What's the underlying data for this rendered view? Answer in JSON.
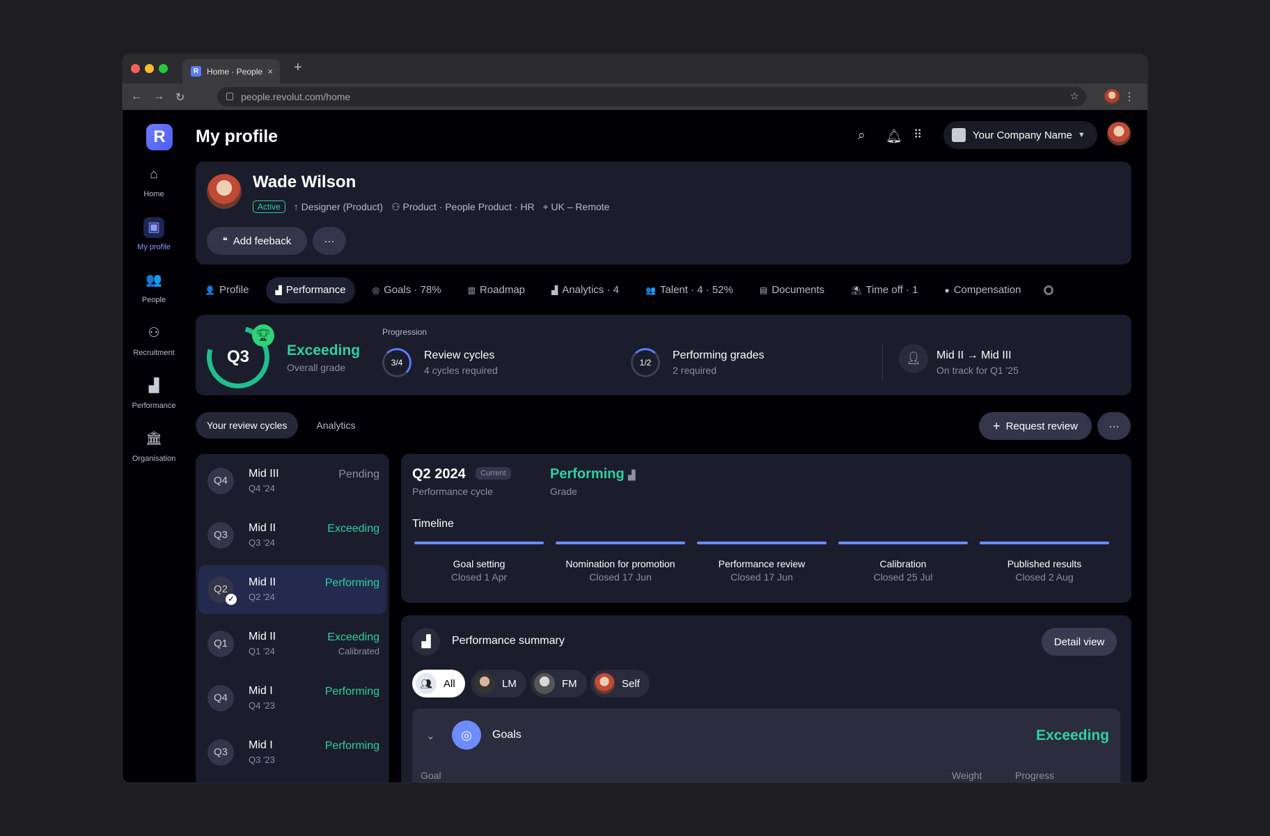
{
  "browser": {
    "tab_title": "Home · People",
    "tab_close": "×",
    "new_tab": "+",
    "url": "people.revolut.com/home"
  },
  "header": {
    "logo": "R",
    "page_title": "My profile",
    "company": "Your Company Name"
  },
  "sidenav": [
    {
      "label": "Home",
      "icon": "home-icon",
      "glyph": "⌂"
    },
    {
      "label": "My profile",
      "icon": "profile-card-icon",
      "glyph": "▣"
    },
    {
      "label": "People",
      "icon": "people-icon",
      "glyph": "👥"
    },
    {
      "label": "Recruitment",
      "icon": "recruitment-icon",
      "glyph": "⚇"
    },
    {
      "label": "Performance",
      "icon": "performance-icon",
      "glyph": "▟"
    },
    {
      "label": "Organisation",
      "icon": "organisation-icon",
      "glyph": "🏛"
    }
  ],
  "profile": {
    "name": "Wade Wilson",
    "status": "Active",
    "role": "Designer (Product)",
    "department": "Product · People Product · HR",
    "location": "UK – Remote",
    "add_feedback": "Add feeback",
    "more": "···"
  },
  "tabs": [
    {
      "label": "Profile",
      "glyph": "👤"
    },
    {
      "label": "Performance",
      "glyph": "▟"
    },
    {
      "label": "Goals · 78%",
      "glyph": "◎"
    },
    {
      "label": "Roadmap",
      "glyph": "▥"
    },
    {
      "label": "Analytics · 4",
      "glyph": "▟"
    },
    {
      "label": "Talent · 4 · 52%",
      "glyph": "👥"
    },
    {
      "label": "Documents",
      "glyph": "▤"
    },
    {
      "label": "Time off · 1",
      "glyph": "⛱"
    },
    {
      "label": "Compensation",
      "glyph": "●"
    }
  ],
  "grade": {
    "quarter": "Q3",
    "label": "Exceeding",
    "sub": "Overall grade",
    "progression_title": "Progression",
    "review_cycles": {
      "ring": "3/4",
      "title": "Review cycles",
      "sub": "4 cycles required",
      "progress": 0.75
    },
    "performing_grades": {
      "ring": "1/2",
      "title": "Performing grades",
      "sub": "2 required",
      "progress": 0.5
    },
    "next_level": {
      "title": "Mid II → Mid III",
      "sub": "On track for Q1 '25"
    }
  },
  "pill_tabs": [
    "Your review cycles",
    "Analytics"
  ],
  "actions": {
    "request_review": "Request review",
    "more": "···"
  },
  "cycles": [
    {
      "q": "Q4",
      "level": "Mid III",
      "date": "Q4 '24",
      "status": "Pending",
      "status_color": "grey",
      "sub": ""
    },
    {
      "q": "Q3",
      "level": "Mid II",
      "date": "Q3 '24",
      "status": "Exceeding",
      "status_color": "green",
      "sub": ""
    },
    {
      "q": "Q2",
      "level": "Mid II",
      "date": "Q2 '24",
      "status": "Performing",
      "status_color": "green",
      "sub": "",
      "active": true
    },
    {
      "q": "Q1",
      "level": "Mid II",
      "date": "Q1 '24",
      "status": "Exceeding",
      "status_color": "green",
      "sub": "Calibrated"
    },
    {
      "q": "Q4",
      "level": "Mid I",
      "date": "Q4 '23",
      "status": "Performing",
      "status_color": "green",
      "sub": ""
    },
    {
      "q": "Q3",
      "level": "Mid I",
      "date": "Q3 '23",
      "status": "Performing",
      "status_color": "green",
      "sub": ""
    }
  ],
  "detail": {
    "title": "Q2 2024",
    "tag": "Current",
    "cycle_label": "Performance cycle",
    "grade": "Performing",
    "grade_label": "Grade",
    "timeline_label": "Timeline",
    "steps": [
      {
        "name": "Goal setting",
        "closed": "Closed 1 Apr"
      },
      {
        "name": "Nomination for promotion",
        "closed": "Closed 17 Jun"
      },
      {
        "name": "Performance review",
        "closed": "Closed 17 Jun"
      },
      {
        "name": "Calibration",
        "closed": "Closed 25 Jul"
      },
      {
        "name": "Published results",
        "closed": "Closed 2 Aug"
      }
    ]
  },
  "summary": {
    "title": "Performance summary",
    "detail_view": "Detail view",
    "chips": [
      "All",
      "LM",
      "FM",
      "Self"
    ],
    "goals_label": "Goals",
    "goals_status": "Exceeding",
    "col_goal": "Goal",
    "col_weight": "Weight",
    "col_progress": "Progress"
  },
  "colors": {
    "accent": "#5b7cff",
    "positive": "#2fd2a0",
    "card": "#1b1c2c"
  }
}
